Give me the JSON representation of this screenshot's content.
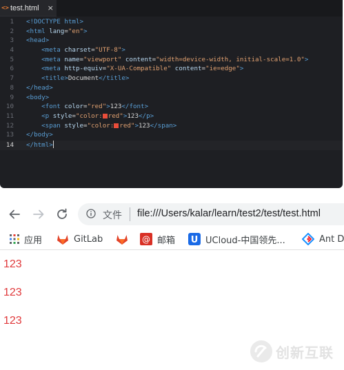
{
  "editor": {
    "tab": {
      "icon": "<>",
      "title": "test.html",
      "close": "×"
    },
    "line_numbers": [
      "1",
      "2",
      "3",
      "4",
      "5",
      "6",
      "7",
      "8",
      "9",
      "10",
      "11",
      "12",
      "13",
      "14"
    ],
    "code": {
      "l1": {
        "t": "<!DOCTYPE ",
        "k": "html",
        "e": ">"
      },
      "l2": {
        "t": "<html ",
        "a": "lang",
        "eq": "=",
        "v": "\"en\"",
        "e": ">"
      },
      "l3": {
        "t": "<head>"
      },
      "l4": {
        "t": "<meta ",
        "a": "charset",
        "eq": "=",
        "v": "\"UTF-8\"",
        "e": ">"
      },
      "l5": {
        "t": "<meta ",
        "a1": "name",
        "eq1": "=",
        "v1": "\"viewport\"",
        "a2": " content",
        "eq2": "=",
        "v2": "\"width=device-width, initial-scale=1.0\"",
        "e": ">"
      },
      "l6": {
        "t": "<meta ",
        "a1": "http-equiv",
        "eq1": "=",
        "v1": "\"X-UA-Compatible\"",
        "a2": " content",
        "eq2": "=",
        "v2": "\"ie=edge\"",
        "e": ">"
      },
      "l7": {
        "t": "<title>",
        "x": "Document",
        "e": "</title>"
      },
      "l8": {
        "t": "</head>"
      },
      "l9": {
        "t": "<body>"
      },
      "l10": {
        "t": "<font ",
        "a": "color",
        "eq": "=",
        "v": "\"red\"",
        "e": ">",
        "x": "123",
        "c": "</font>"
      },
      "l11": {
        "t": "<p ",
        "a": "style",
        "eq": "=",
        "v1": "\"color:",
        "v2": "red\"",
        "e": ">",
        "x": "123",
        "c": "</p>"
      },
      "l12": {
        "t": "<span ",
        "a": "style",
        "eq": "=",
        "v1": "\"color:",
        "v2": "red\"",
        "e": ">",
        "x": "123",
        "c": "</span>"
      },
      "l13": {
        "t": "</body>"
      },
      "l14": {
        "t1": "<",
        "t2": "/html>"
      }
    },
    "colors": {
      "tag": "#5a9fd6",
      "attr": "#b8d8f0",
      "string": "#e0a070",
      "swatch": "#ea4d3a"
    }
  },
  "browser": {
    "back_icon": "arrow-left-icon",
    "forward_icon": "arrow-right-icon",
    "reload_icon": "reload-icon",
    "url_label": "文件",
    "url": "file:///Users/kalar/learn/test2/test/test.html",
    "bookmarks": [
      {
        "label": "应用",
        "icon": "apps-grid-icon"
      },
      {
        "label": "GitLab",
        "icon": "gitlab-icon"
      },
      {
        "label": "",
        "icon": "gitlab-icon"
      },
      {
        "label": "邮箱",
        "icon": "mail-icon"
      },
      {
        "label": "UCloud-中国领先...",
        "icon": "ucloud-icon"
      },
      {
        "label": "Ant D",
        "icon": "ant-design-icon"
      }
    ],
    "output": [
      "123",
      "123",
      "123"
    ],
    "output_color": "#e0383a"
  },
  "watermark": {
    "text": "创新互联"
  }
}
